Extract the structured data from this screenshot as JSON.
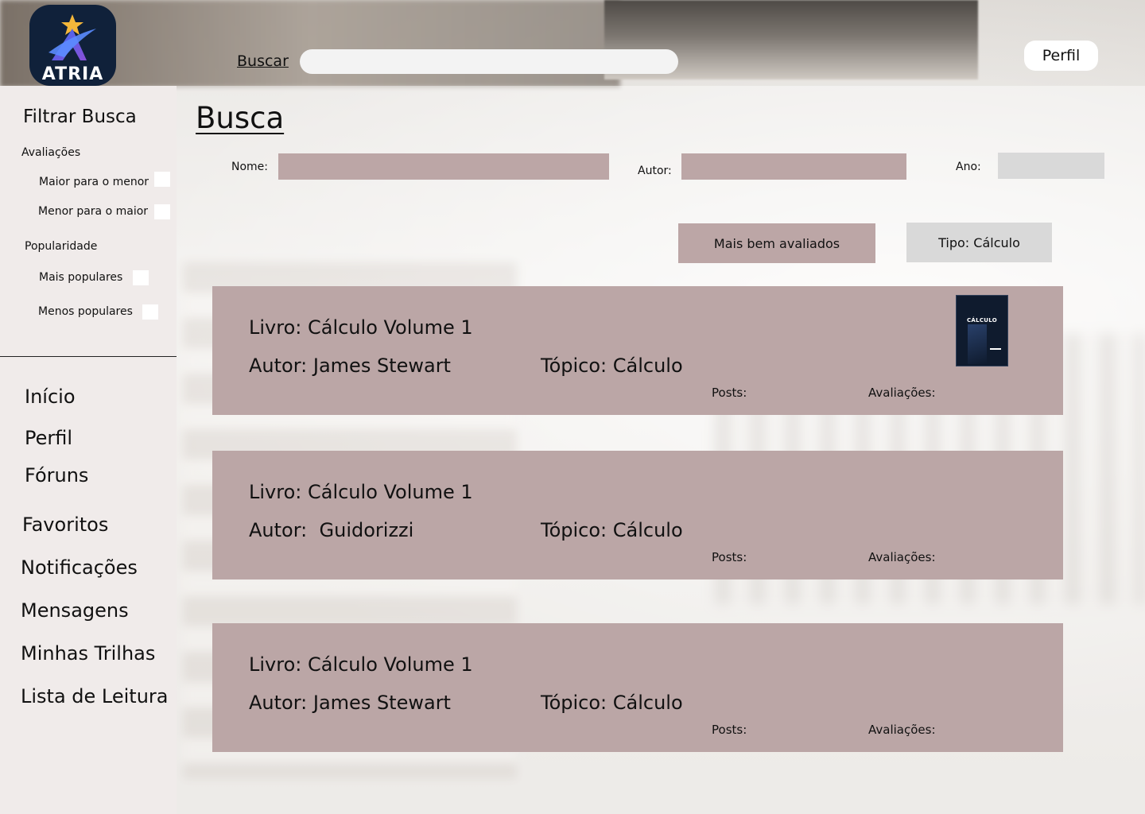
{
  "header": {
    "brand": "ATRIA",
    "search_label": "Buscar",
    "search_value": "",
    "profile_button": "Perfil"
  },
  "sidebar": {
    "filter_title": "Filtrar Busca",
    "ratings_group": "Avaliações",
    "ratings_options": [
      "Maior para o menor",
      "Menor para o maior"
    ],
    "popularity_group": "Popularidade",
    "popularity_options": [
      "Mais populares",
      "Menos populares"
    ],
    "nav": [
      "Início",
      "Perfil",
      "Fóruns",
      "Favoritos",
      "Notificações",
      "Mensagens",
      "Minhas Trilhas",
      "Lista de Leitura"
    ]
  },
  "main": {
    "title": "Busca",
    "filters": {
      "name_label": "Nome:",
      "author_label": "Autor:",
      "year_label": "Ano:"
    },
    "chips": {
      "best_rated": "Mais bem avaliados",
      "type": "Tipo: Cálculo"
    },
    "results": [
      {
        "book": "Livro: Cálculo Volume 1",
        "author": "Autor: James Stewart",
        "topic": "Tópico: Cálculo",
        "posts": "Posts:",
        "ratings": "Avaliações:",
        "cover_title": "CÁLCULO"
      },
      {
        "book": "Livro: Cálculo Volume 1",
        "author": "Autor:  Guidorizzi",
        "topic": "Tópico: Cálculo",
        "posts": "Posts:",
        "ratings": "Avaliações:"
      },
      {
        "book": "Livro: Cálculo Volume 1",
        "author": "Autor: James Stewart",
        "topic": "Tópico: Cálculo",
        "posts": "Posts:",
        "ratings": "Avaliações:"
      }
    ]
  },
  "colors": {
    "card": "#bba6a6",
    "sidebar": "#f0ebea",
    "logo_bg": "#10213a"
  }
}
